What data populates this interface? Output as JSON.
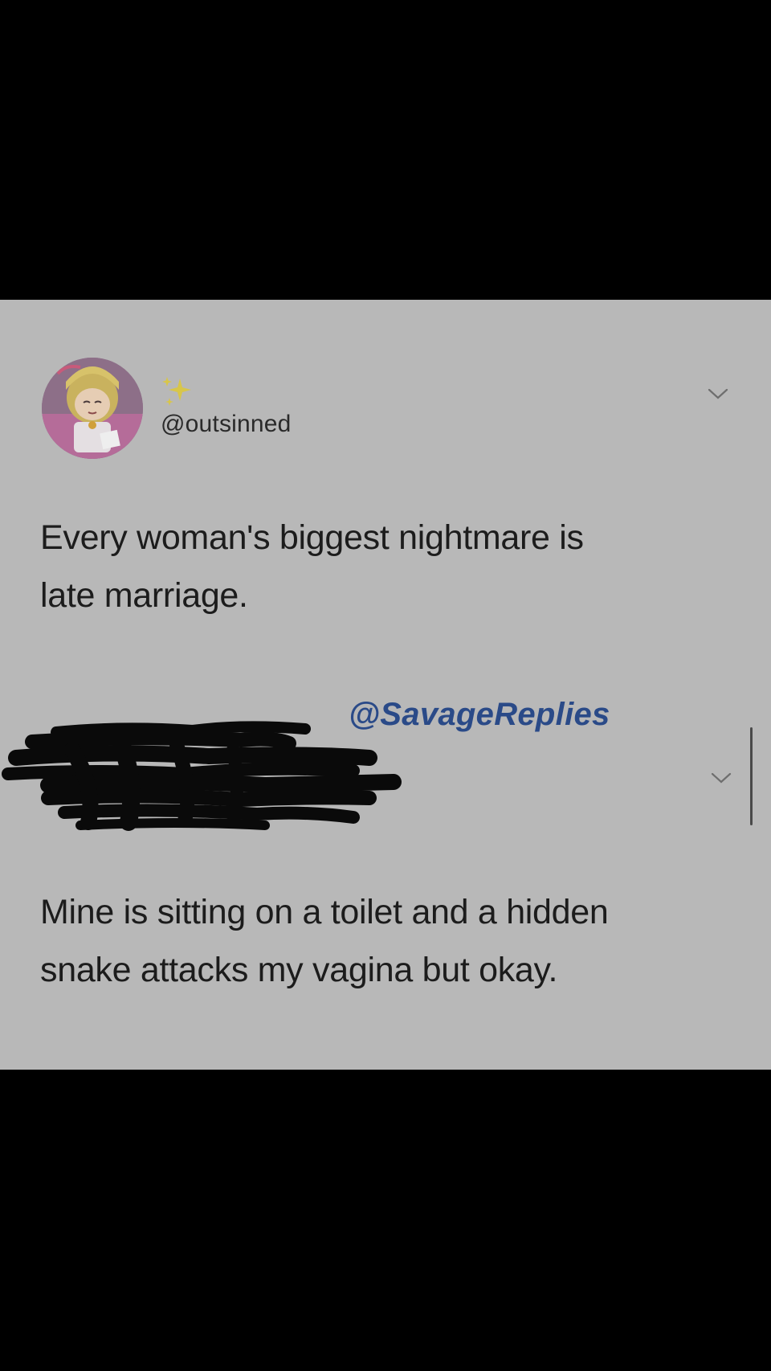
{
  "tweet": {
    "username": "@outsinned",
    "text_lines": [
      "Every woman's biggest nightmare is",
      "late marriage."
    ]
  },
  "watermark": "@SavageReplies",
  "reply": {
    "text_lines": [
      "Mine is sitting on a toilet and a hidden",
      "snake attacks my vagina but okay."
    ]
  },
  "icons": {
    "sparkle": "sparkles-icon",
    "menu": "chevron-down-icon",
    "avatar": "anime-avatar"
  },
  "colors": {
    "background": "#000000",
    "card": "#b8b8b8",
    "text": "#1c1c1c",
    "watermark": "#2a4a88"
  }
}
